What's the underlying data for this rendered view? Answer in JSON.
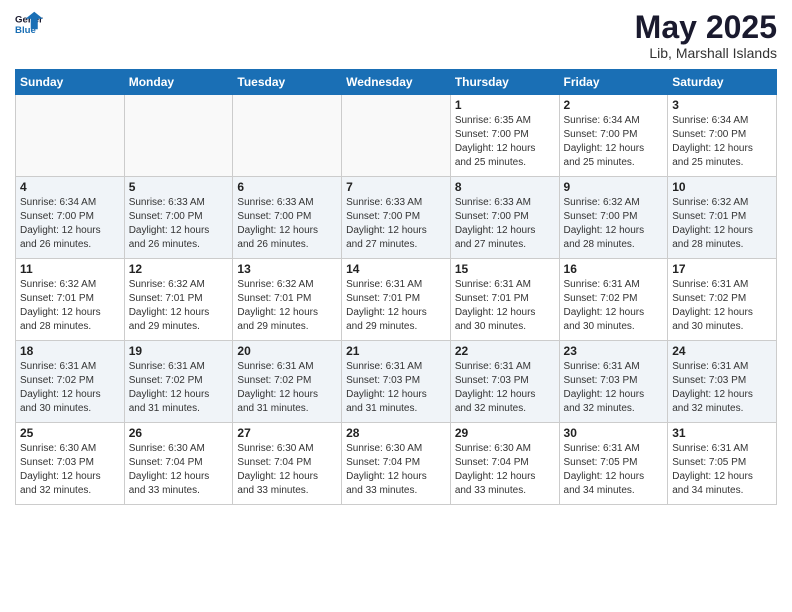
{
  "header": {
    "logo_general": "General",
    "logo_blue": "Blue",
    "month": "May 2025",
    "location": "Lib, Marshall Islands"
  },
  "weekdays": [
    "Sunday",
    "Monday",
    "Tuesday",
    "Wednesday",
    "Thursday",
    "Friday",
    "Saturday"
  ],
  "weeks": [
    [
      {
        "day": "",
        "info": ""
      },
      {
        "day": "",
        "info": ""
      },
      {
        "day": "",
        "info": ""
      },
      {
        "day": "",
        "info": ""
      },
      {
        "day": "1",
        "info": "Sunrise: 6:35 AM\nSunset: 7:00 PM\nDaylight: 12 hours\nand 25 minutes."
      },
      {
        "day": "2",
        "info": "Sunrise: 6:34 AM\nSunset: 7:00 PM\nDaylight: 12 hours\nand 25 minutes."
      },
      {
        "day": "3",
        "info": "Sunrise: 6:34 AM\nSunset: 7:00 PM\nDaylight: 12 hours\nand 25 minutes."
      }
    ],
    [
      {
        "day": "4",
        "info": "Sunrise: 6:34 AM\nSunset: 7:00 PM\nDaylight: 12 hours\nand 26 minutes."
      },
      {
        "day": "5",
        "info": "Sunrise: 6:33 AM\nSunset: 7:00 PM\nDaylight: 12 hours\nand 26 minutes."
      },
      {
        "day": "6",
        "info": "Sunrise: 6:33 AM\nSunset: 7:00 PM\nDaylight: 12 hours\nand 26 minutes."
      },
      {
        "day": "7",
        "info": "Sunrise: 6:33 AM\nSunset: 7:00 PM\nDaylight: 12 hours\nand 27 minutes."
      },
      {
        "day": "8",
        "info": "Sunrise: 6:33 AM\nSunset: 7:00 PM\nDaylight: 12 hours\nand 27 minutes."
      },
      {
        "day": "9",
        "info": "Sunrise: 6:32 AM\nSunset: 7:00 PM\nDaylight: 12 hours\nand 28 minutes."
      },
      {
        "day": "10",
        "info": "Sunrise: 6:32 AM\nSunset: 7:01 PM\nDaylight: 12 hours\nand 28 minutes."
      }
    ],
    [
      {
        "day": "11",
        "info": "Sunrise: 6:32 AM\nSunset: 7:01 PM\nDaylight: 12 hours\nand 28 minutes."
      },
      {
        "day": "12",
        "info": "Sunrise: 6:32 AM\nSunset: 7:01 PM\nDaylight: 12 hours\nand 29 minutes."
      },
      {
        "day": "13",
        "info": "Sunrise: 6:32 AM\nSunset: 7:01 PM\nDaylight: 12 hours\nand 29 minutes."
      },
      {
        "day": "14",
        "info": "Sunrise: 6:31 AM\nSunset: 7:01 PM\nDaylight: 12 hours\nand 29 minutes."
      },
      {
        "day": "15",
        "info": "Sunrise: 6:31 AM\nSunset: 7:01 PM\nDaylight: 12 hours\nand 30 minutes."
      },
      {
        "day": "16",
        "info": "Sunrise: 6:31 AM\nSunset: 7:02 PM\nDaylight: 12 hours\nand 30 minutes."
      },
      {
        "day": "17",
        "info": "Sunrise: 6:31 AM\nSunset: 7:02 PM\nDaylight: 12 hours\nand 30 minutes."
      }
    ],
    [
      {
        "day": "18",
        "info": "Sunrise: 6:31 AM\nSunset: 7:02 PM\nDaylight: 12 hours\nand 30 minutes."
      },
      {
        "day": "19",
        "info": "Sunrise: 6:31 AM\nSunset: 7:02 PM\nDaylight: 12 hours\nand 31 minutes."
      },
      {
        "day": "20",
        "info": "Sunrise: 6:31 AM\nSunset: 7:02 PM\nDaylight: 12 hours\nand 31 minutes."
      },
      {
        "day": "21",
        "info": "Sunrise: 6:31 AM\nSunset: 7:03 PM\nDaylight: 12 hours\nand 31 minutes."
      },
      {
        "day": "22",
        "info": "Sunrise: 6:31 AM\nSunset: 7:03 PM\nDaylight: 12 hours\nand 32 minutes."
      },
      {
        "day": "23",
        "info": "Sunrise: 6:31 AM\nSunset: 7:03 PM\nDaylight: 12 hours\nand 32 minutes."
      },
      {
        "day": "24",
        "info": "Sunrise: 6:31 AM\nSunset: 7:03 PM\nDaylight: 12 hours\nand 32 minutes."
      }
    ],
    [
      {
        "day": "25",
        "info": "Sunrise: 6:30 AM\nSunset: 7:03 PM\nDaylight: 12 hours\nand 32 minutes."
      },
      {
        "day": "26",
        "info": "Sunrise: 6:30 AM\nSunset: 7:04 PM\nDaylight: 12 hours\nand 33 minutes."
      },
      {
        "day": "27",
        "info": "Sunrise: 6:30 AM\nSunset: 7:04 PM\nDaylight: 12 hours\nand 33 minutes."
      },
      {
        "day": "28",
        "info": "Sunrise: 6:30 AM\nSunset: 7:04 PM\nDaylight: 12 hours\nand 33 minutes."
      },
      {
        "day": "29",
        "info": "Sunrise: 6:30 AM\nSunset: 7:04 PM\nDaylight: 12 hours\nand 33 minutes."
      },
      {
        "day": "30",
        "info": "Sunrise: 6:31 AM\nSunset: 7:05 PM\nDaylight: 12 hours\nand 34 minutes."
      },
      {
        "day": "31",
        "info": "Sunrise: 6:31 AM\nSunset: 7:05 PM\nDaylight: 12 hours\nand 34 minutes."
      }
    ]
  ]
}
